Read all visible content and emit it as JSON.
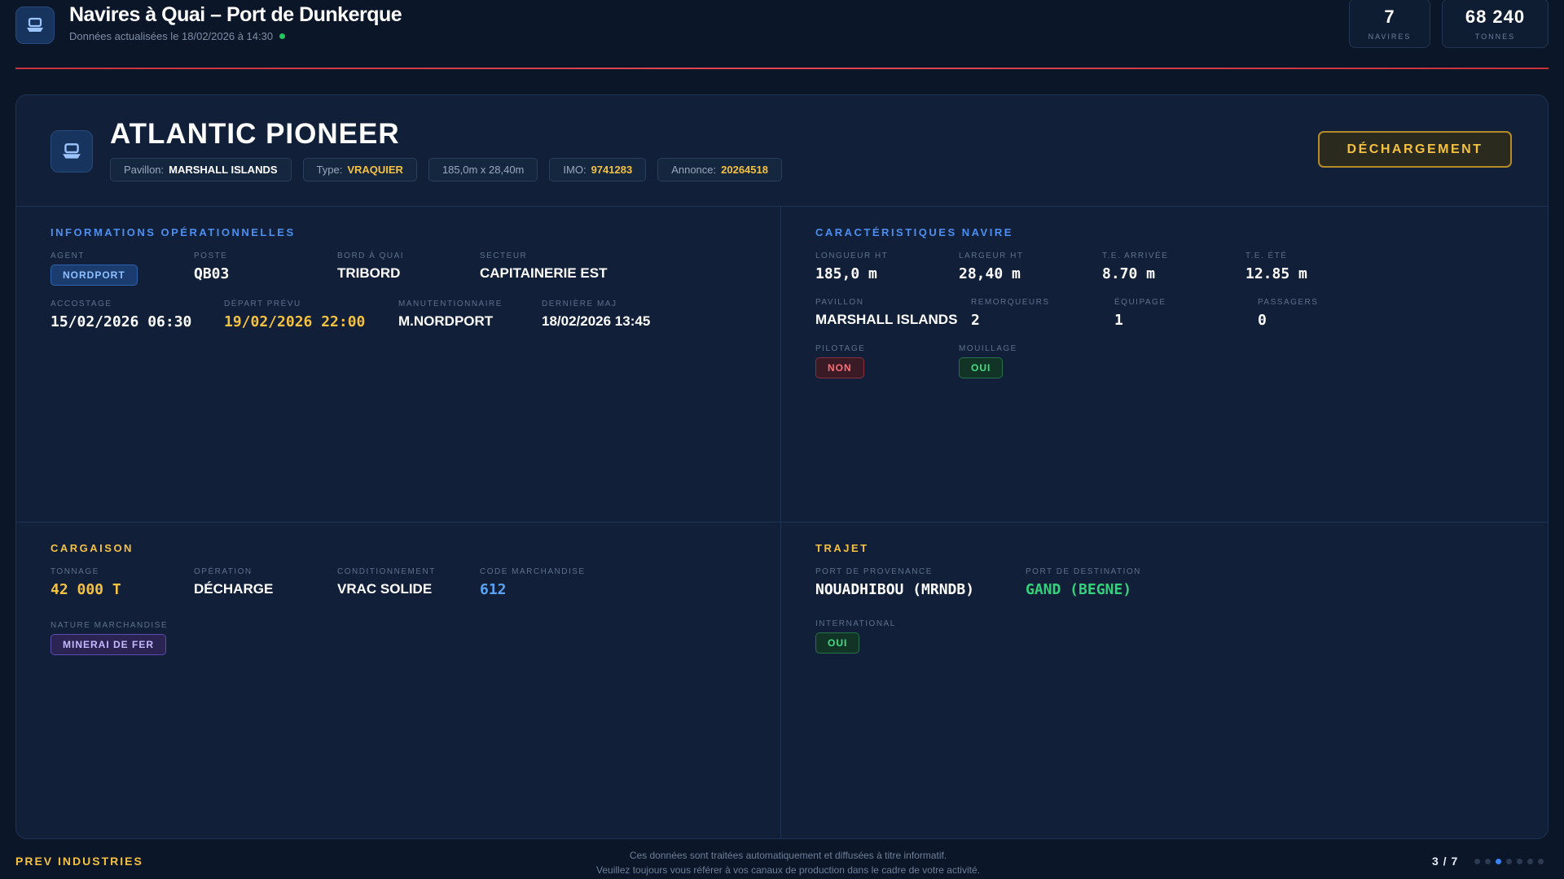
{
  "header": {
    "icon": "ship-icon",
    "title": "Navires à Quai – Port de Dunkerque",
    "subtitle": "Données actualisées le 18/02/2026 à 14:30",
    "live_color": "#22c55e",
    "stats": [
      {
        "value": "7",
        "label": "NAVIRES"
      },
      {
        "value": "68 240",
        "label": "TONNES"
      }
    ]
  },
  "vessel": {
    "name": "ATLANTIC PIONEER",
    "icon": "ship-icon",
    "status": "DÉCHARGEMENT",
    "chips": {
      "pavillon_label": "Pavillon:",
      "pavillon_value": "MARSHALL ISLANDS",
      "type_label": "Type:",
      "type_value": "VRAQUIER",
      "dimensions": "185,0m x 28,40m",
      "imo_label": "IMO:",
      "imo_value": "9741283",
      "annonce_label": "Annonce:",
      "annonce_value": "20264518"
    }
  },
  "operations": {
    "title": "INFORMATIONS OPÉRATIONNELLES",
    "agent_label": "AGENT",
    "agent_value": "NORDPORT",
    "poste_label": "POSTE",
    "poste_value": "QB03",
    "bord_label": "BORD À QUAI",
    "bord_value": "TRIBORD",
    "secteur_label": "SECTEUR",
    "secteur_value": "CAPITAINERIE EST",
    "accostage_label": "ACCOSTAGE",
    "accostage_value": "15/02/2026 06:30",
    "depart_label": "DÉPART PRÉVU",
    "depart_value": "19/02/2026 22:00",
    "manut_label": "MANUTENTIONNAIRE",
    "manut_value": "M.NORDPORT",
    "maj_label": "DERNIÈRE MAJ",
    "maj_value": "18/02/2026 13:45"
  },
  "characteristics": {
    "title": "CARACTÉRISTIQUES NAVIRE",
    "longueur_label": "LONGUEUR HT",
    "longueur_value": "185,0 m",
    "largeur_label": "LARGEUR HT",
    "largeur_value": "28,40 m",
    "te_arrivee_label": "T.E. ARRIVÉE",
    "te_arrivee_value": "8.70 m",
    "te_ete_label": "T.E. ÉTÉ",
    "te_ete_value": "12.85 m",
    "pavillon_label": "PAVILLON",
    "pavillon_value": "MARSHALL ISLANDS",
    "remorqueurs_label": "REMORQUEURS",
    "remorqueurs_value": "2",
    "equipage_label": "ÉQUIPAGE",
    "equipage_value": "1",
    "passagers_label": "PASSAGERS",
    "passagers_value": "0",
    "pilotage_label": "PILOTAGE",
    "pilotage_value": "NON",
    "mouillage_label": "MOUILLAGE",
    "mouillage_value": "OUI"
  },
  "cargo": {
    "title": "CARGAISON",
    "tonnage_label": "TONNAGE",
    "tonnage_value": "42 000 T",
    "operation_label": "OPÉRATION",
    "operation_value": "DÉCHARGE",
    "conditionnement_label": "CONDITIONNEMENT",
    "conditionnement_value": "VRAC SOLIDE",
    "code_label": "CODE MARCHANDISE",
    "code_value": "612",
    "nature_label": "NATURE MARCHANDISE",
    "nature_value": "MINERAI DE FER"
  },
  "route": {
    "title": "TRAJET",
    "provenance_label": "PORT DE PROVENANCE",
    "provenance_value": "NOUADHIBOU (MRNDB)",
    "destination_label": "PORT DE DESTINATION",
    "destination_value": "GAND (BEGNE)",
    "international_label": "INTERNATIONAL",
    "international_value": "OUI"
  },
  "footer": {
    "brand": "PREV INDUSTRIES",
    "note_line1": "Ces données sont traitées automatiquement et diffusées à titre informatif.",
    "note_line2": "Veuillez toujours vous référer à vos canaux de production dans le cadre de votre activité.",
    "pager": "3 / 7",
    "current_page": 3,
    "total_pages": 7
  },
  "colors": {
    "background": "#0b1628",
    "panel": "#112038",
    "accent_blue": "#4d8ff0",
    "accent_yellow": "#f5c142",
    "accent_red": "#e2474f",
    "accent_green": "#33d17a"
  }
}
